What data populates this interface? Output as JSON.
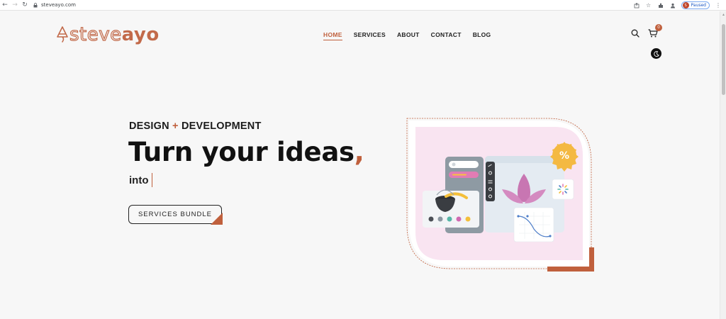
{
  "browser": {
    "url": "steveayo.com",
    "profile_initial": "S",
    "profile_status": "Paused"
  },
  "header": {
    "logo_light": "steve",
    "logo_bold": "ayo",
    "nav": [
      {
        "label": "HOME",
        "active": true
      },
      {
        "label": "SERVICES",
        "active": false
      },
      {
        "label": "ABOUT",
        "active": false
      },
      {
        "label": "CONTACT",
        "active": false
      },
      {
        "label": "BLOG",
        "active": false
      }
    ],
    "cart_count": "0"
  },
  "hero": {
    "tagline_left": "DESIGN",
    "tagline_plus": "+",
    "tagline_right": "DEVELOPMENT",
    "headline": "Turn your ideas",
    "headline_comma": ",",
    "subline": "into",
    "button_label": "SERVICES BUNDLE",
    "badge_symbol": "%"
  },
  "colors": {
    "accent": "#c0603d",
    "background": "#f7f7f7",
    "hero_panel": "#f9e4f1"
  }
}
